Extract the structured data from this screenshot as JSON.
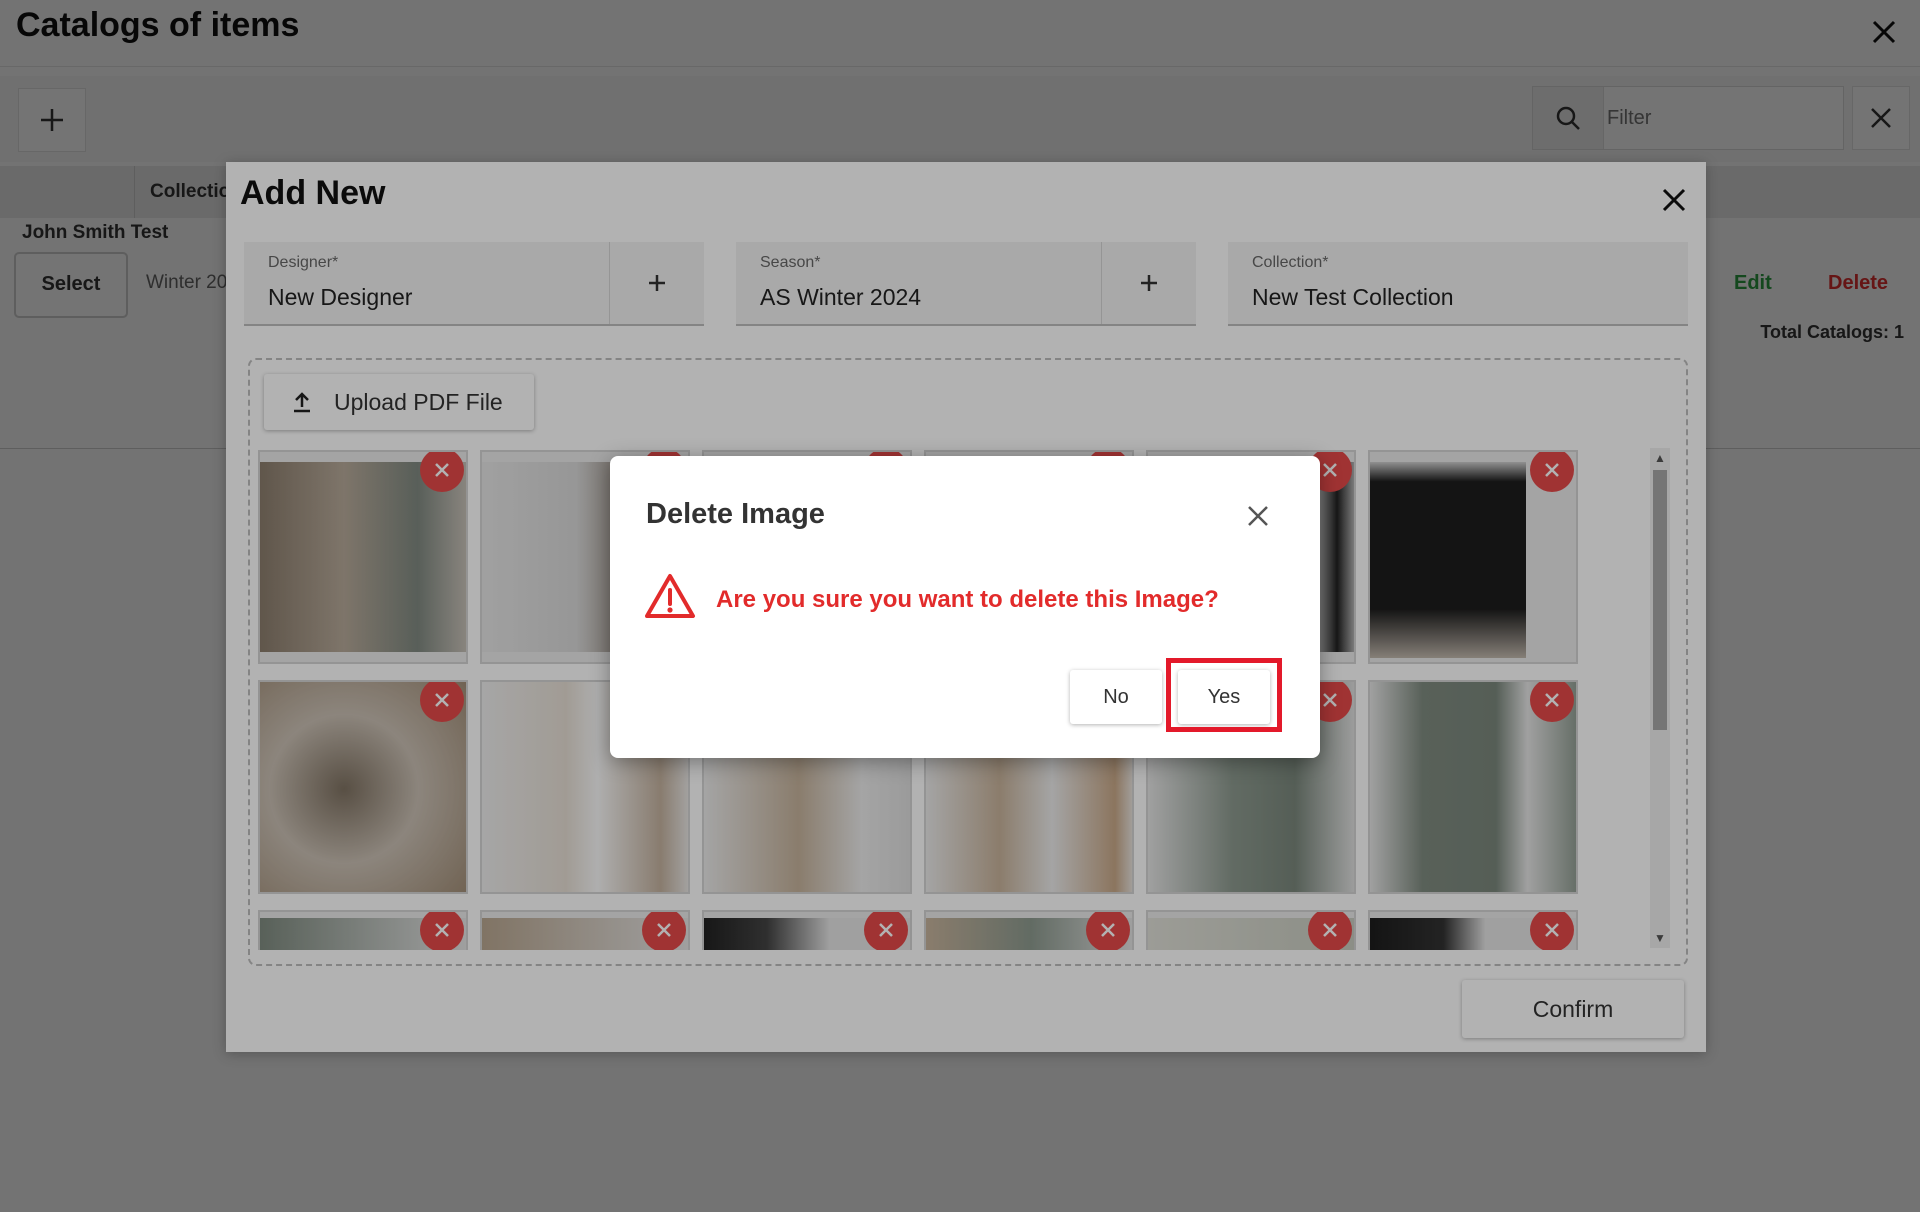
{
  "page": {
    "title": "Catalogs of items",
    "filter_placeholder": "Filter",
    "grid_header": {
      "collection_col": "Collectio"
    },
    "row": {
      "name": "John Smith Test",
      "select_label": "Select",
      "season": "Winter 20",
      "edit_label": "Edit",
      "delete_label": "Delete"
    },
    "total": "Total Catalogs: 1"
  },
  "add_new": {
    "title": "Add New",
    "designer": {
      "label": "Designer*",
      "value": "New Designer"
    },
    "season": {
      "label": "Season*",
      "value": "AS Winter 2024"
    },
    "collection": {
      "label": "Collection*",
      "value": "New Test Collection"
    },
    "upload_label": "Upload PDF File",
    "confirm_label": "Confirm"
  },
  "dialog": {
    "title": "Delete Image",
    "message": "Are you sure you want to delete this Image?",
    "no_label": "No",
    "yes_label": "Yes"
  },
  "colors": {
    "danger": "#e22b2b",
    "edit_green": "#2f9e44",
    "highlight": "#e3192a"
  }
}
